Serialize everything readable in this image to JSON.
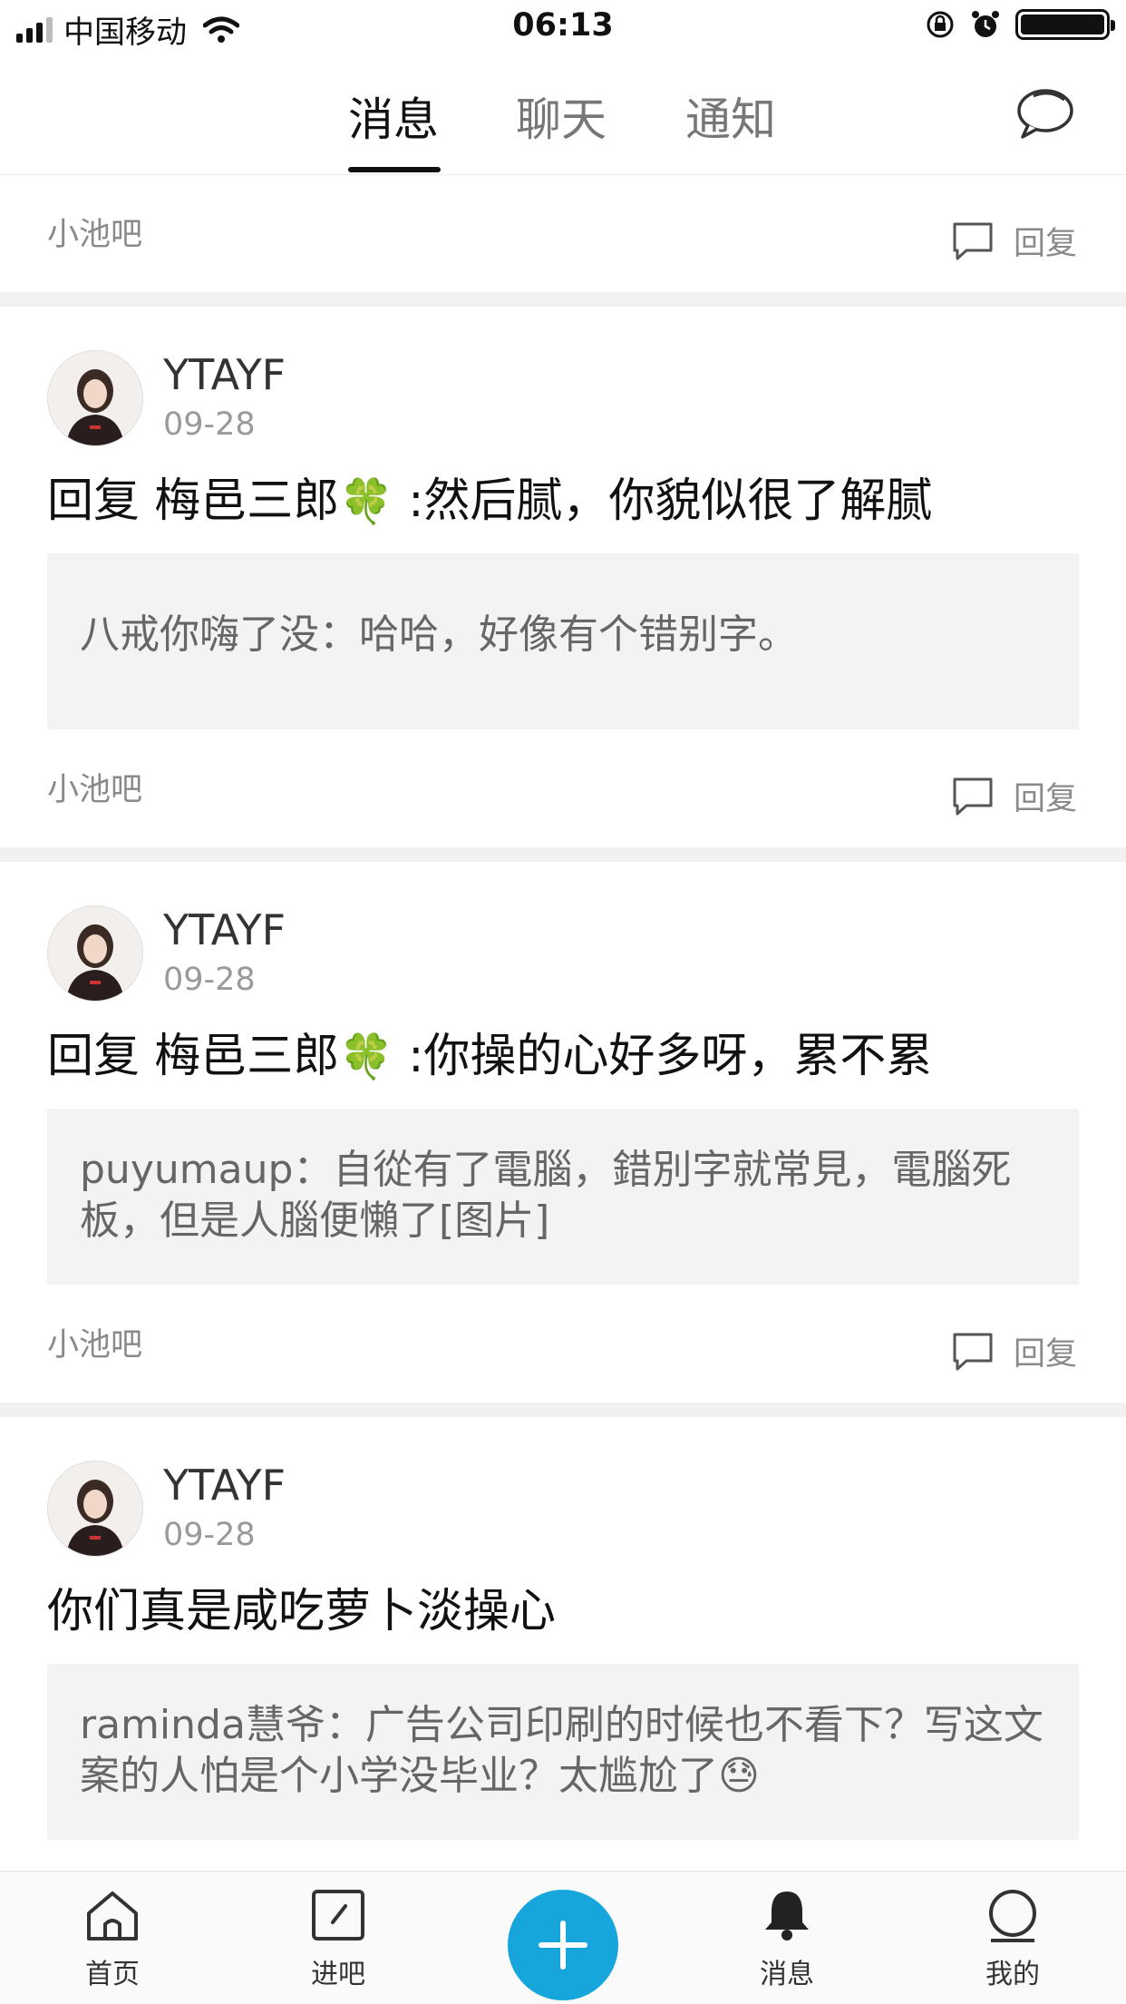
{
  "status_bar": {
    "carrier": "中国移动",
    "time": "06:13"
  },
  "tabs": [
    {
      "label": "消息",
      "active": true
    },
    {
      "label": "聊天",
      "active": false
    },
    {
      "label": "通知",
      "active": false
    }
  ],
  "first_footer": {
    "forum": "小池吧",
    "reply_label": "回复"
  },
  "cards": [
    {
      "user": "YTAYF",
      "date": "09-28",
      "reply_prefix": "回复 梅邑三郎",
      "reply_emoji": "🍀",
      "reply_body": " :然后腻，你貌似很了解腻",
      "quote_text": "八戒你嗨了没：哈哈，好像有个错别字。",
      "forum": "小池吧",
      "reply_label": "回复"
    },
    {
      "user": "YTAYF",
      "date": "09-28",
      "reply_prefix": "回复 梅邑三郎",
      "reply_emoji": "🍀",
      "reply_body": " :你操的心好多呀，累不累",
      "quote_text": "puyumaup：自從有了電腦，錯別字就常見，電腦死板，但是人腦便懶了[图片]",
      "forum": "小池吧",
      "reply_label": "回复"
    },
    {
      "user": "YTAYF",
      "date": "09-28",
      "reply_text": "你们真是咸吃萝卜淡操心",
      "quote_text": "raminda慧爷：广告公司印刷的时候也不看下？写这文案的人怕是个小学没毕业？太尴尬了",
      "quote_emoji": "😓"
    }
  ],
  "bottom_nav": [
    {
      "label": "首页",
      "icon": "home-icon"
    },
    {
      "label": "进吧",
      "icon": "enter-forum-icon"
    },
    {
      "label": "消息",
      "icon": "bell-icon"
    },
    {
      "label": "我的",
      "icon": "profile-icon"
    }
  ],
  "colors": {
    "accent": "#16a6dc",
    "divider": "#f1f1f1",
    "quote_bg": "#f3f3f3"
  }
}
